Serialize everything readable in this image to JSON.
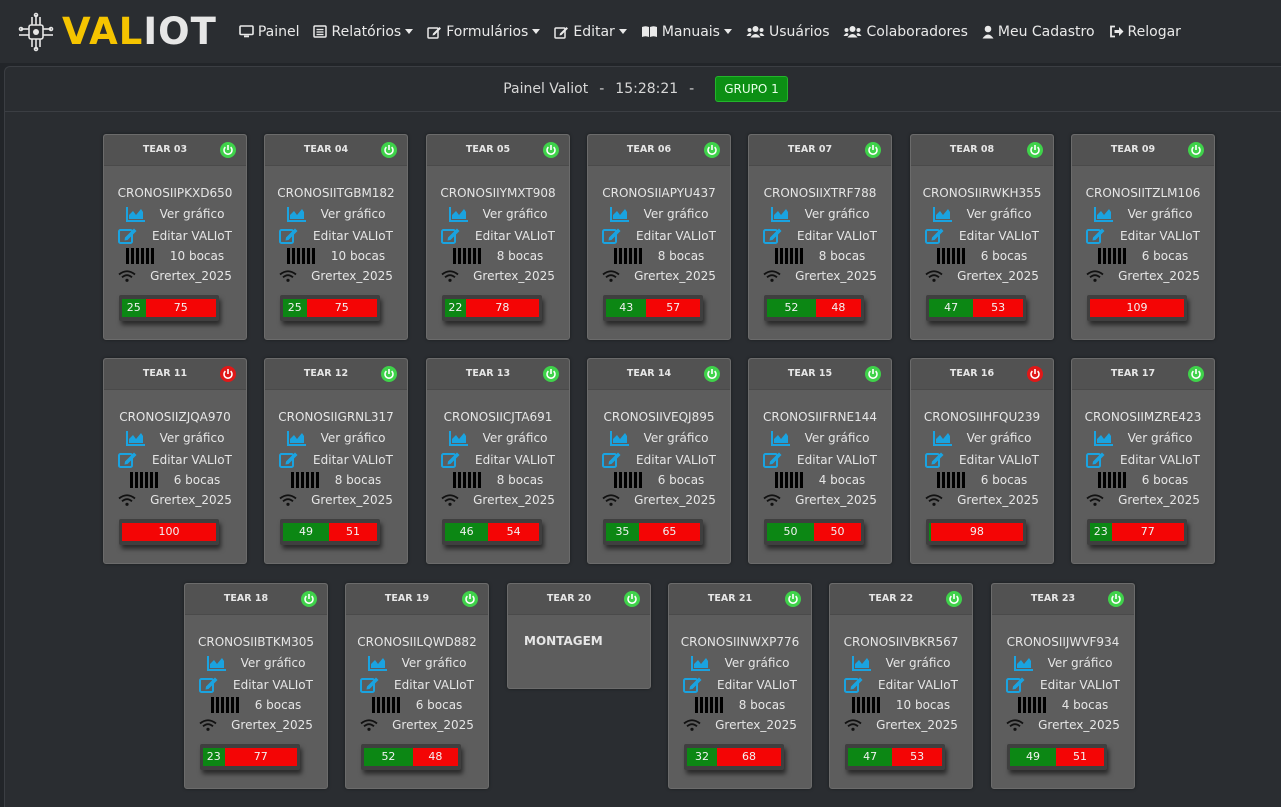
{
  "brand": {
    "part1": "VAL",
    "part2": "IOT"
  },
  "nav": [
    {
      "label": "Painel",
      "icon": "monitor-icon",
      "caret": false
    },
    {
      "label": "Relatórios",
      "icon": "list-icon",
      "caret": true
    },
    {
      "label": "Formulários",
      "icon": "edit-icon",
      "caret": true
    },
    {
      "label": "Editar",
      "icon": "edit-icon",
      "caret": true
    },
    {
      "label": "Manuais",
      "icon": "book-icon",
      "caret": true
    },
    {
      "label": "Usuários",
      "icon": "users-icon",
      "caret": false
    },
    {
      "label": "Colaboradores",
      "icon": "users-icon",
      "caret": false
    },
    {
      "label": "Meu Cadastro",
      "icon": "user-icon",
      "caret": false
    },
    {
      "label": "Relogar",
      "icon": "sign-out-icon",
      "caret": false
    }
  ],
  "header": {
    "title": "Painel Valiot",
    "separator": "-",
    "time": "15:28:21",
    "group_button": "GRUPO 1"
  },
  "labels": {
    "chart": "Ver gráfico",
    "edit": "Editar VALIoT",
    "wifi": "Grertex_2025"
  },
  "colors": {
    "on": "#3fd24a",
    "off": "#e01818",
    "green": "#0c8714",
    "red": "#f40505",
    "icon_blue": "#1aa3e0",
    "brand_yellow": "#f5c400"
  },
  "cards": [
    {
      "title": "TEAR 03",
      "status": "on",
      "serial": "CRONOSIIPKXD650",
      "bocas": "10 bocas",
      "green": 25,
      "red": 75
    },
    {
      "title": "TEAR 04",
      "status": "on",
      "serial": "CRONOSIITGBM182",
      "bocas": "10 bocas",
      "green": 25,
      "red": 75
    },
    {
      "title": "TEAR 05",
      "status": "on",
      "serial": "CRONOSIIYMXT908",
      "bocas": "8 bocas",
      "green": 22,
      "red": 78
    },
    {
      "title": "TEAR 06",
      "status": "on",
      "serial": "CRONOSIIAPYU437",
      "bocas": "8 bocas",
      "green": 43,
      "red": 57
    },
    {
      "title": "TEAR 07",
      "status": "on",
      "serial": "CRONOSIIXTRF788",
      "bocas": "8 bocas",
      "green": 52,
      "red": 48
    },
    {
      "title": "TEAR 08",
      "status": "on",
      "serial": "CRONOSIIRWKH355",
      "bocas": "6 bocas",
      "green": 47,
      "red": 53
    },
    {
      "title": "TEAR 09",
      "status": "on",
      "serial": "CRONOSIITZLM106",
      "bocas": "6 bocas",
      "green": 0,
      "red": 109
    },
    {
      "title": "TEAR 11",
      "status": "off",
      "serial": "CRONOSIIZJQA970",
      "bocas": "6 bocas",
      "green": 0,
      "red": 100
    },
    {
      "title": "TEAR 12",
      "status": "on",
      "serial": "CRONOSIIGRNL317",
      "bocas": "8 bocas",
      "green": 49,
      "red": 51
    },
    {
      "title": "TEAR 13",
      "status": "on",
      "serial": "CRONOSIICJTA691",
      "bocas": "8 bocas",
      "green": 46,
      "red": 54
    },
    {
      "title": "TEAR 14",
      "status": "on",
      "serial": "CRONOSIIVEQJ895",
      "bocas": "6 bocas",
      "green": 35,
      "red": 65
    },
    {
      "title": "TEAR 15",
      "status": "on",
      "serial": "CRONOSIIFRNE144",
      "bocas": "4 bocas",
      "green": 50,
      "red": 50
    },
    {
      "title": "TEAR 16",
      "status": "off",
      "serial": "CRONOSIIHFQU239",
      "bocas": "6 bocas",
      "green": 2,
      "red": 98
    },
    {
      "title": "TEAR 17",
      "status": "on",
      "serial": "CRONOSIIMZRE423",
      "bocas": "6 bocas",
      "green": 23,
      "red": 77
    },
    {
      "title": "TEAR 18",
      "status": "on",
      "serial": "CRONOSIIBTKM305",
      "bocas": "6 bocas",
      "green": 23,
      "red": 77
    },
    {
      "title": "TEAR 19",
      "status": "on",
      "serial": "CRONOSIILQWD882",
      "bocas": "6 bocas",
      "green": 52,
      "red": 48
    },
    {
      "title": "TEAR 20",
      "status": "on",
      "note": "MONTAGEM"
    },
    {
      "title": "TEAR 21",
      "status": "on",
      "serial": "CRONOSIINWXP776",
      "bocas": "8 bocas",
      "green": 32,
      "red": 68
    },
    {
      "title": "TEAR 22",
      "status": "on",
      "serial": "CRONOSIIVBKR567",
      "bocas": "10 bocas",
      "green": 47,
      "red": 53
    },
    {
      "title": "TEAR 23",
      "status": "on",
      "serial": "CRONOSIIJWVF934",
      "bocas": "4 bocas",
      "green": 49,
      "red": 51
    }
  ]
}
